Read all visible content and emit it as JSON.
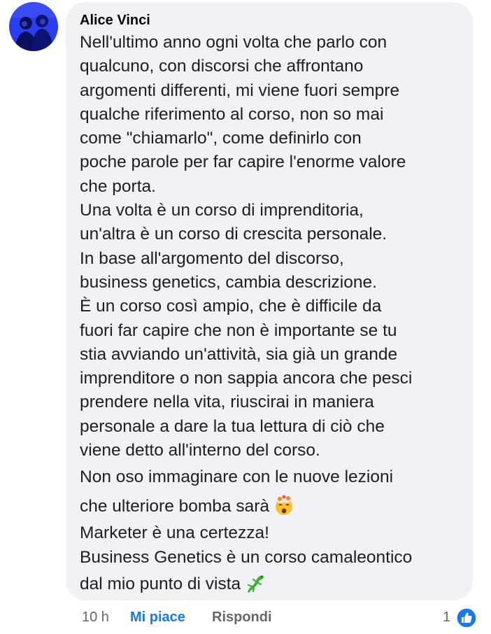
{
  "comment": {
    "author": "Alice Vinci",
    "avatar_icon": "avatar-photo",
    "lines": [
      "Nell'ultimo anno ogni volta che parlo con",
      "qualcuno, con discorsi che affrontano",
      "argomenti differenti, mi viene fuori sempre",
      "qualche riferimento al corso, non so mai",
      "come \"chiamarlo\", come definirlo con",
      "poche parole per far capire l'enorme valore",
      "che porta.",
      "Una volta è un corso di imprenditoria,",
      "un'altra è un corso di crescita personale.",
      "In base all'argomento del discorso,",
      "business genetics, cambia descrizione.",
      "È un corso così ampio, che è difficile da",
      "fuori far capire che non è importante se tu",
      "stia avviando un'attività, sia già un grande",
      "imprenditore o non sappia ancora che pesci",
      "prendere nella vita, riuscirai in maniera",
      "personale a dare la tua lettura di ciò che",
      "viene detto all'interno del corso.",
      "Non oso immaginare con le nuove lezioni",
      "che ulteriore bomba sarà",
      "Marketer è una certezza!",
      "Business Genetics è un corso camaleontico",
      "dal mio punto di vista"
    ],
    "emoji_exploding_head": "exploding-head-emoji",
    "emoji_lizard": "lizard-emoji"
  },
  "footer": {
    "time": "10 h",
    "like_label": "Mi piace",
    "reply_label": "Rispondi",
    "reaction_count": "1",
    "reaction_icon": "thumbs-up-icon"
  },
  "colors": {
    "bubble_bg": "#f0f2f5",
    "like_blue": "#1877f2",
    "meta_gray": "#65676b",
    "avatar_blue": "#2a3ef0"
  }
}
